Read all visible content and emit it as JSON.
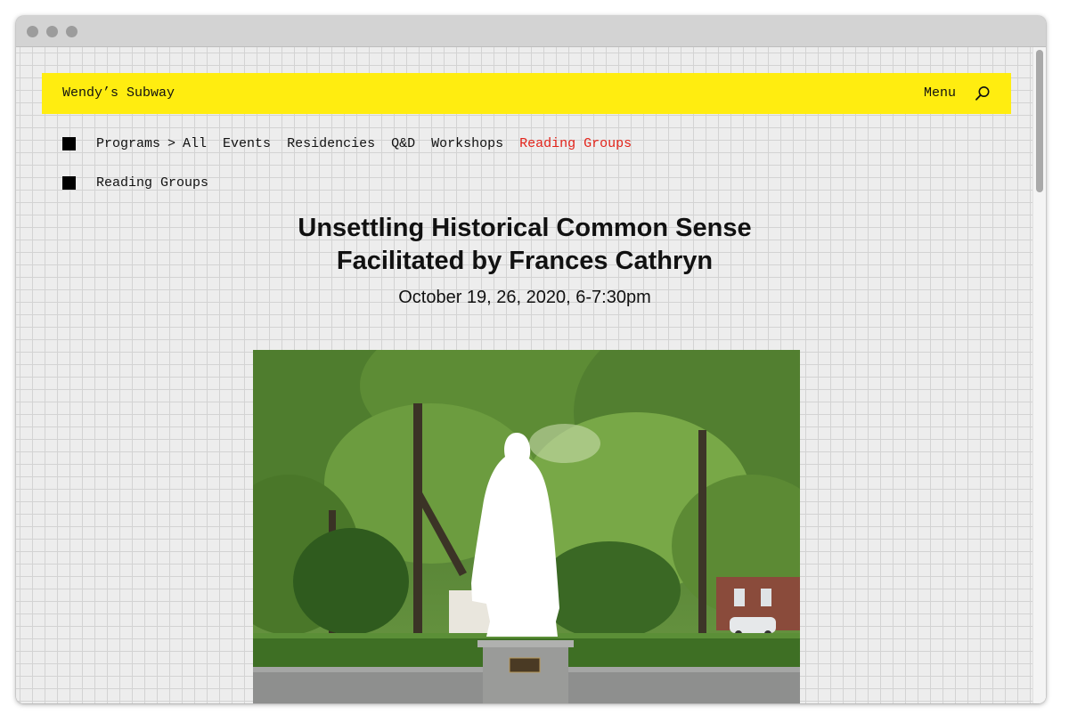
{
  "header": {
    "site_title": "Wendy’s Subway",
    "menu_label": "Menu",
    "brand_color": "#ffed10"
  },
  "nav": {
    "breadcrumb": {
      "section": "Programs",
      "separator": ">",
      "current": "All"
    },
    "items": [
      {
        "label": "Events"
      },
      {
        "label": "Residencies"
      },
      {
        "label": "Q&D"
      },
      {
        "label": "Workshops"
      },
      {
        "label": "Reading Groups",
        "active": true
      }
    ],
    "active_color": "#e2231a"
  },
  "category": {
    "label": "Reading Groups"
  },
  "event": {
    "title_line1": "Unsettling Historical Common Sense",
    "title_line2": "Facilitated by Frances Cathryn",
    "date": "October 19, 26, 2020, 6-7:30pm"
  },
  "icons": {
    "search": "search-icon",
    "bullet": "square-bullet-icon"
  }
}
